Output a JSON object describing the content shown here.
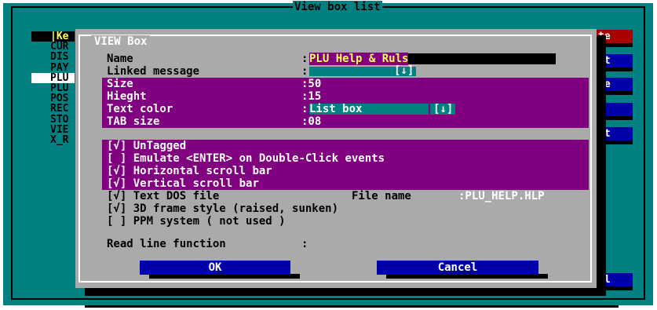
{
  "background": {
    "title": "View box list",
    "list": [
      "|Ke",
      "CUR",
      "DIS",
      "PAY",
      "PLU",
      "PLU",
      "POS",
      "REC",
      "STO",
      "VIE",
      "X_R"
    ],
    "right_buttons": [
      "te",
      "rt",
      "te",
      "y",
      "rt",
      "el"
    ]
  },
  "dialog": {
    "title": "VIEW Box",
    "fields": {
      "name_label": "Name",
      "name_colon": ":",
      "name_value": "PLU Help & Ruls",
      "linked_label": "Linked message",
      "linked_colon": ":",
      "linked_arrow": "[↓]",
      "size_label": "Size",
      "size_value": ":50",
      "height_label": "Hieght",
      "height_value": ":15",
      "color_label": "Text color",
      "color_colon": ":",
      "color_value": "List box",
      "color_arrow": "[↓]",
      "tab_label": "TAB size",
      "tab_value": ":08"
    },
    "options": [
      {
        "mark": "[√]",
        "label": "UnTagged"
      },
      {
        "mark": "[ ]",
        "label": "Emulate <ENTER> on Double-Click events"
      },
      {
        "mark": "[√]",
        "label": "Horizontal scroll bar"
      },
      {
        "mark": "[√]",
        "label": "Vertical scroll bar"
      },
      {
        "mark": "[√]",
        "label": "Text DOS file"
      },
      {
        "mark": "[√]",
        "label": "3D frame style (raised, sunken)"
      },
      {
        "mark": "[ ]",
        "label": "PPM system ( not used )"
      }
    ],
    "file_name_label": "File name",
    "file_name_value": ":PLU_HELP.HLP",
    "read_line_label": "Read line function",
    "read_line_colon": ":",
    "ok_label": "OK",
    "cancel_label": "Cancel"
  },
  "colors": {
    "desktop": "#008080",
    "dialog": "#aaaaaa",
    "highlight": "#800080",
    "button": "#0000a8",
    "input": "#000000",
    "value_text": "#ffff55"
  }
}
